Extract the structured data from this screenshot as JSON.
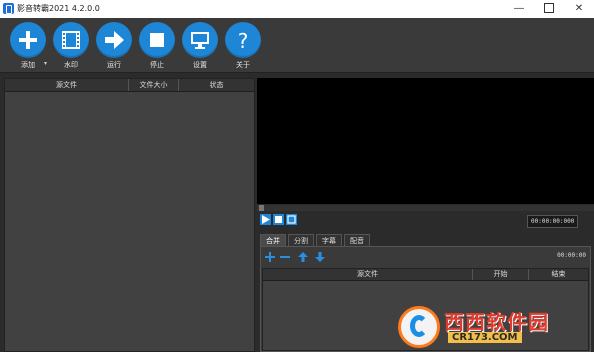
{
  "window": {
    "title": "影音转霸2021 4.2.0.0",
    "controls": [
      "minimize-icon",
      "maximize-icon",
      "close-icon"
    ]
  },
  "toolbar": {
    "buttons": [
      {
        "label": "添加",
        "icon": "plus-icon"
      },
      {
        "label": "水印",
        "icon": "film-icon"
      },
      {
        "label": "运行",
        "icon": "arrow-right-icon"
      },
      {
        "label": "停止",
        "icon": "stop-icon"
      },
      {
        "label": "设置",
        "icon": "monitor-icon"
      },
      {
        "label": "关于",
        "icon": "question-icon"
      }
    ],
    "accent_color": "#1e86d6"
  },
  "file_list": {
    "columns": [
      "源文件",
      "文件大小",
      "状态"
    ]
  },
  "player": {
    "controls": [
      "play-icon",
      "stop-icon",
      "fullscreen-icon"
    ],
    "timecode": "00:00:00:000"
  },
  "tabs": {
    "items": [
      "合并",
      "分割",
      "字幕",
      "配音"
    ],
    "active": "合并"
  },
  "merge_panel": {
    "actions": [
      "add-icon",
      "remove-icon",
      "move-up-icon",
      "move-down-icon"
    ],
    "time": "00:00:00",
    "columns": [
      "源文件",
      "开始",
      "结束"
    ]
  },
  "watermark": {
    "brand": "西西软件园",
    "site": "CR173.COM"
  }
}
